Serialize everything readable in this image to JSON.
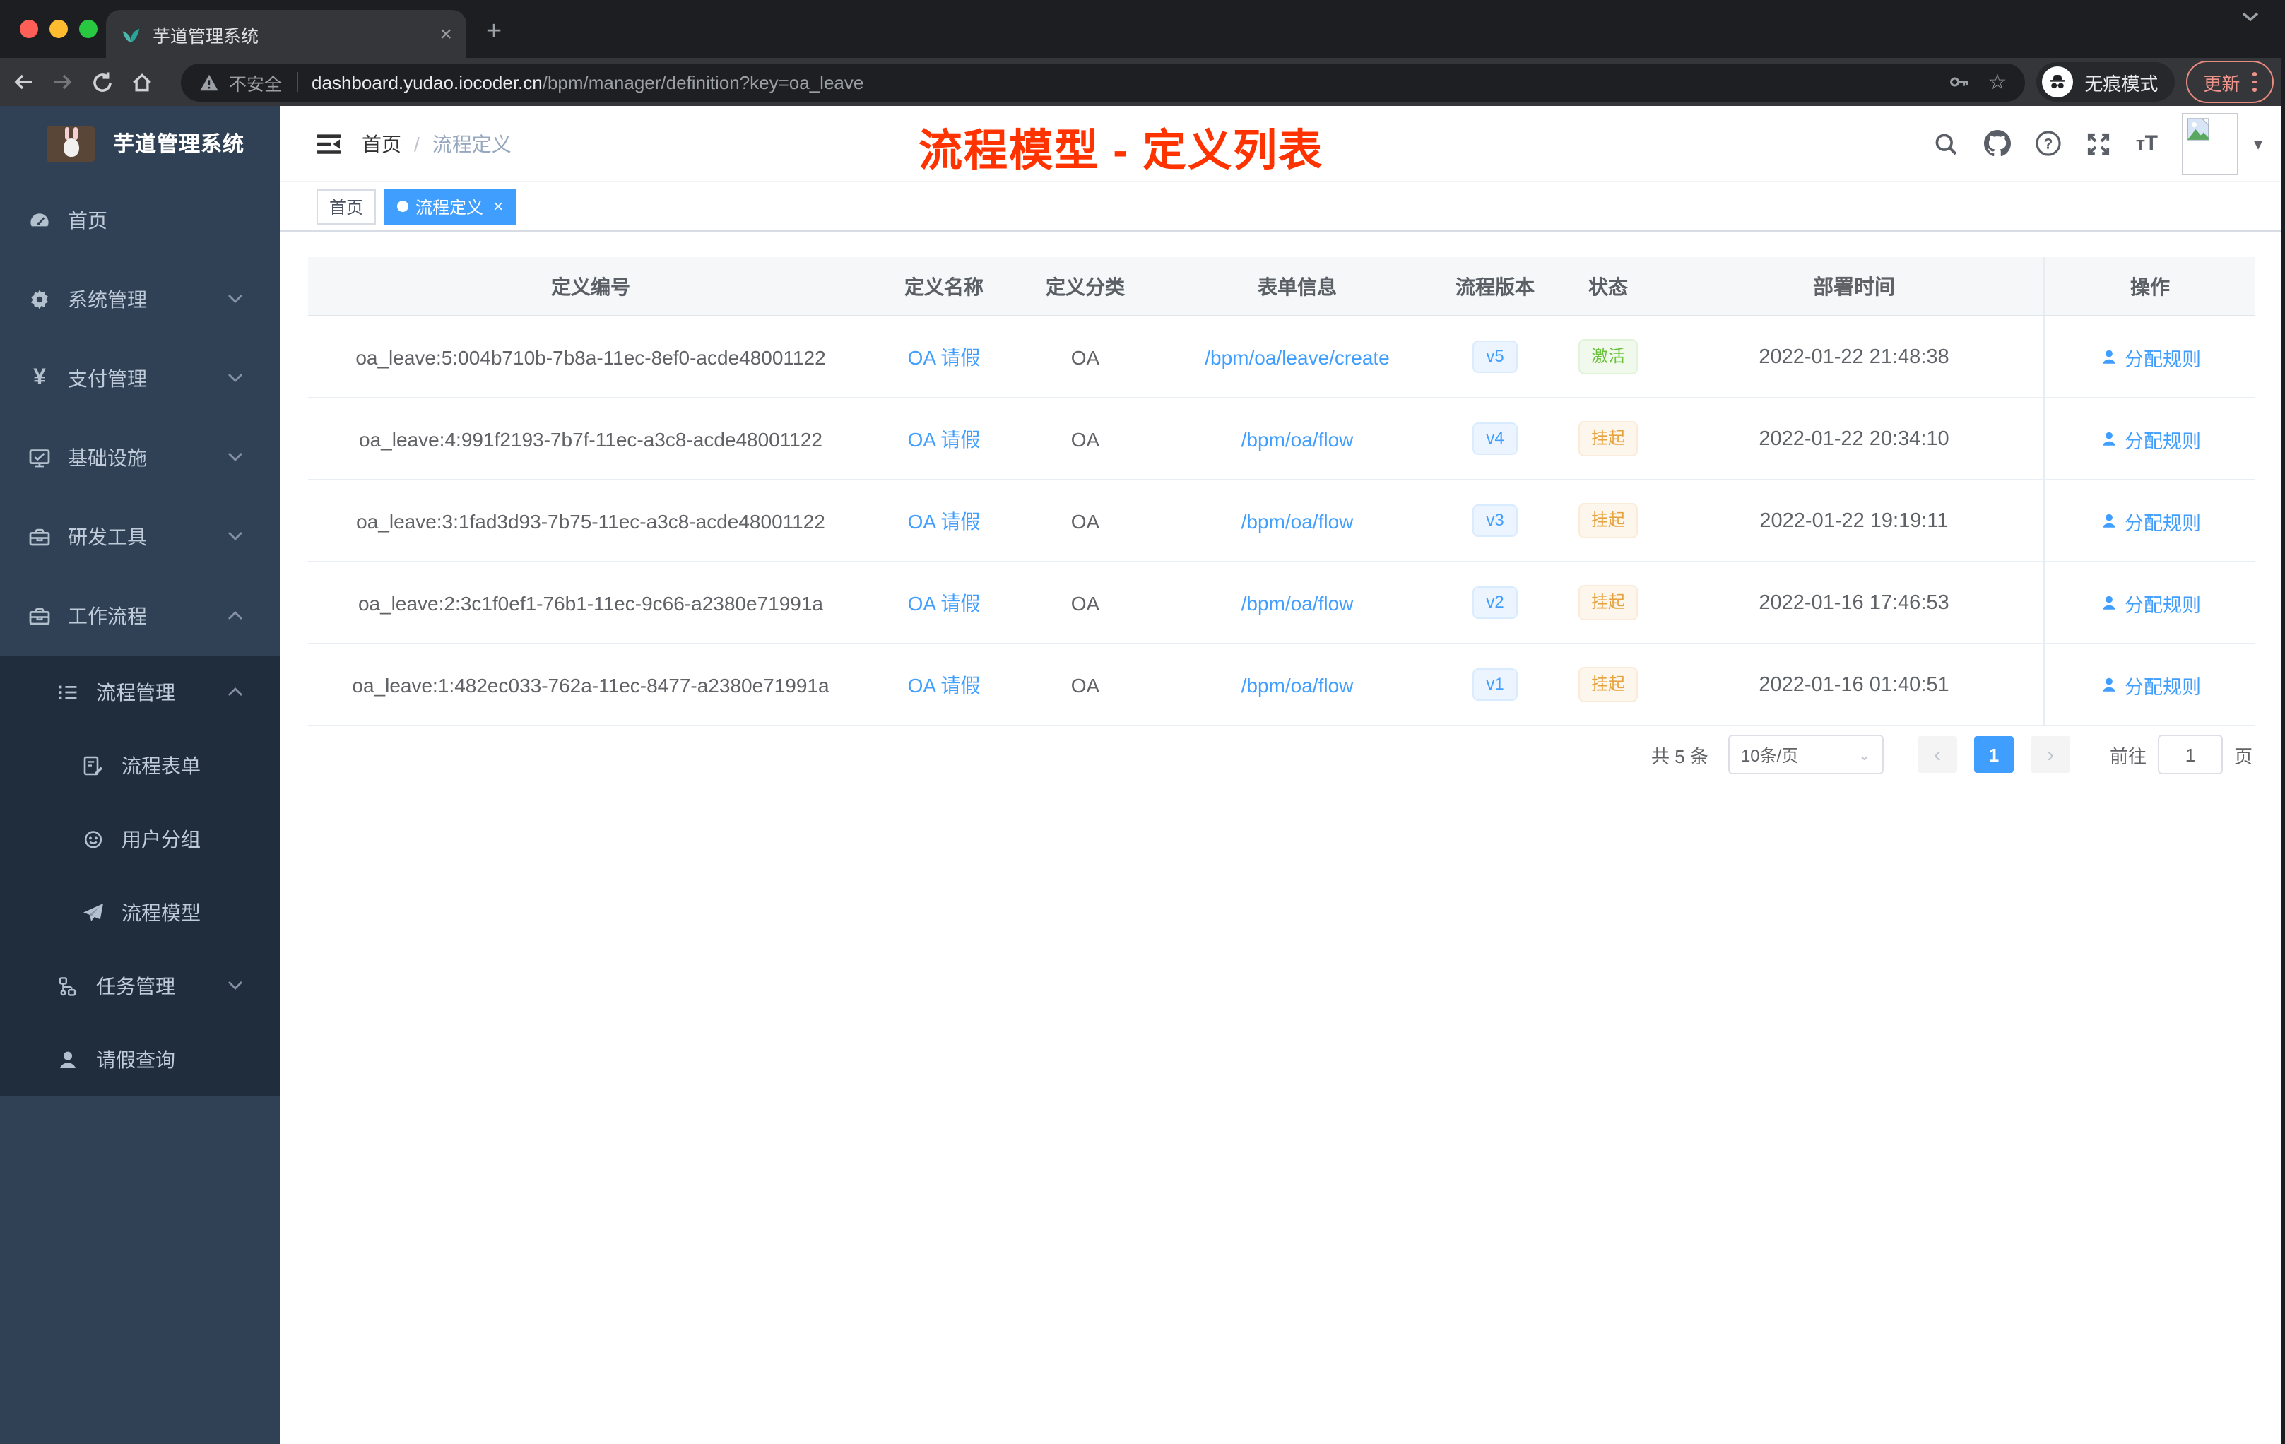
{
  "browser": {
    "tab_title": "芋道管理系统",
    "not_secure_label": "不安全",
    "url_host": "dashboard.yudao.iocoder.cn",
    "url_path": "/bpm/manager/definition?key=oa_leave",
    "incognito_label": "无痕模式",
    "update_label": "更新"
  },
  "glyphs": {
    "close": "×",
    "plus": "+",
    "caret_down": "▾",
    "star": "☆",
    "prev": "‹",
    "next": "›",
    "select_caret": "⌄",
    "size_small": "T",
    "size_big": "T"
  },
  "sidebar": {
    "logo_title": "芋道管理系统",
    "items": [
      {
        "label": "首页",
        "icon": "dashboard-icon"
      },
      {
        "label": "系统管理",
        "icon": "gear-icon"
      },
      {
        "label": "支付管理",
        "icon": "yen-icon"
      },
      {
        "label": "基础设施",
        "icon": "monitor-icon"
      },
      {
        "label": "研发工具",
        "icon": "toolbox-icon"
      },
      {
        "label": "工作流程",
        "icon": "toolbox-icon"
      },
      {
        "label": "流程管理",
        "icon": "list-icon"
      },
      {
        "label": "流程表单",
        "icon": "form-icon"
      },
      {
        "label": "用户分组",
        "icon": "group-icon"
      },
      {
        "label": "流程模型",
        "icon": "paper-plane-icon"
      },
      {
        "label": "任务管理",
        "icon": "flow-tree-icon"
      },
      {
        "label": "请假查询",
        "icon": "user-icon"
      }
    ]
  },
  "header": {
    "breadcrumb_home": "首页",
    "breadcrumb_sep": "/",
    "breadcrumb_current": "流程定义",
    "annotation": "流程模型 - 定义列表"
  },
  "tags": {
    "home": "首页",
    "active": "流程定义"
  },
  "table": {
    "columns": [
      "定义编号",
      "定义名称",
      "定义分类",
      "表单信息",
      "流程版本",
      "状态",
      "部署时间",
      "操作"
    ],
    "rows": [
      {
        "id": "oa_leave:5:004b710b-7b8a-11ec-8ef0-acde48001122",
        "name": "OA 请假",
        "category": "OA",
        "form": "/bpm/oa/leave/create",
        "version": "v5",
        "status": "激活",
        "time": "2022-01-22 21:48:38",
        "action": "分配规则"
      },
      {
        "id": "oa_leave:4:991f2193-7b7f-11ec-a3c8-acde48001122",
        "name": "OA 请假",
        "category": "OA",
        "form": "/bpm/oa/flow",
        "version": "v4",
        "status": "挂起",
        "time": "2022-01-22 20:34:10",
        "action": "分配规则"
      },
      {
        "id": "oa_leave:3:1fad3d93-7b75-11ec-a3c8-acde48001122",
        "name": "OA 请假",
        "category": "OA",
        "form": "/bpm/oa/flow",
        "version": "v3",
        "status": "挂起",
        "time": "2022-01-22 19:19:11",
        "action": "分配规则"
      },
      {
        "id": "oa_leave:2:3c1f0ef1-76b1-11ec-9c66-a2380e71991a",
        "name": "OA 请假",
        "category": "OA",
        "form": "/bpm/oa/flow",
        "version": "v2",
        "status": "挂起",
        "time": "2022-01-16 17:46:53",
        "action": "分配规则"
      },
      {
        "id": "oa_leave:1:482ec033-762a-11ec-8477-a2380e71991a",
        "name": "OA 请假",
        "category": "OA",
        "form": "/bpm/oa/flow",
        "version": "v1",
        "status": "挂起",
        "time": "2022-01-16 01:40:51",
        "action": "分配规则"
      }
    ]
  },
  "pagination": {
    "total": "共 5 条",
    "page_size": "10条/页",
    "current_page": "1",
    "goto_label": "前往",
    "goto_value": "1",
    "page_unit": "页"
  },
  "colors": {
    "accent_blue": "#409eff",
    "annotation_red": "#ff3300",
    "status_active_green": "#67c23a",
    "status_suspend_yellow": "#e6a23c",
    "sidebar_bg": "#304156",
    "sidebar_submenu_bg": "#1f2d3d",
    "chrome_dark": "#35363a",
    "update_red": "#ee938a"
  }
}
